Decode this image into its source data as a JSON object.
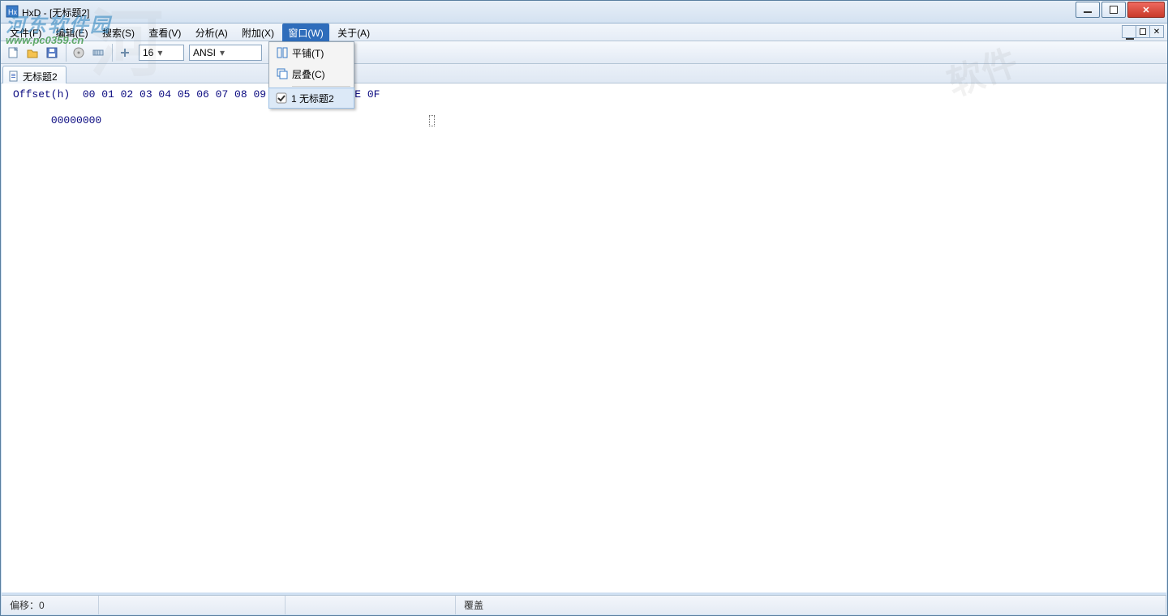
{
  "window": {
    "title": "HxD - [无标题2]"
  },
  "menu": {
    "items": [
      {
        "label": "文件(F)"
      },
      {
        "label": "编辑(E)"
      },
      {
        "label": "搜索(S)"
      },
      {
        "label": "查看(V)"
      },
      {
        "label": "分析(A)"
      },
      {
        "label": "附加(X)"
      },
      {
        "label": "窗口(W)",
        "active": true
      },
      {
        "label": "关于(A)"
      }
    ]
  },
  "popup": {
    "tile": "平铺(T)",
    "cascade": "层叠(C)",
    "doc1": "1 无标题2"
  },
  "toolbar": {
    "bytes_per_row": "16",
    "encoding": "ANSI"
  },
  "tabs": {
    "tab1": "无标题2"
  },
  "hex": {
    "header": "Offset(h)  00 01 02 03 04 05 06 07 08 09 0A 0B 0C 0D 0E 0F",
    "row0": "00000000"
  },
  "status": {
    "offset": "偏移：0",
    "mode": "覆盖"
  },
  "watermark": {
    "line1": "河东软件园",
    "line2": "www.pc0359.cn",
    "seal": "软件"
  }
}
